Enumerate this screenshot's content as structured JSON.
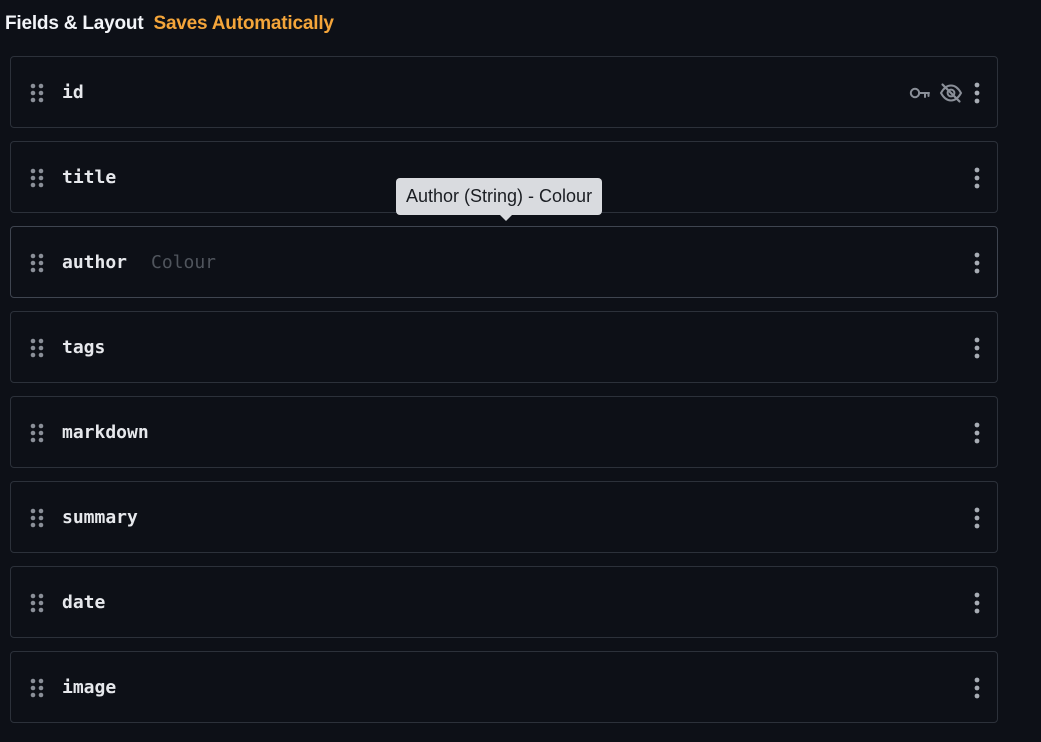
{
  "header": {
    "title": "Fields & Layout",
    "subtitle": "Saves Automatically"
  },
  "colors": {
    "background": "#0d1017",
    "accent": "#f4a53a",
    "border": "#2c313a",
    "text": "#e6e8ec",
    "muted": "#50555d",
    "tooltip_bg": "#d9dbdf"
  },
  "fields": [
    {
      "name": "id",
      "note": "",
      "icons": [
        "key-icon",
        "eye-off-icon",
        "more-vertical-icon"
      ]
    },
    {
      "name": "title",
      "note": "",
      "icons": [
        "more-vertical-icon"
      ]
    },
    {
      "name": "author",
      "note": "Colour",
      "icons": [
        "more-vertical-icon"
      ]
    },
    {
      "name": "tags",
      "note": "",
      "icons": [
        "more-vertical-icon"
      ]
    },
    {
      "name": "markdown",
      "note": "",
      "icons": [
        "more-vertical-icon"
      ]
    },
    {
      "name": "summary",
      "note": "",
      "icons": [
        "more-vertical-icon"
      ]
    },
    {
      "name": "date",
      "note": "",
      "icons": [
        "more-vertical-icon"
      ]
    },
    {
      "name": "image",
      "note": "",
      "icons": [
        "more-vertical-icon"
      ]
    }
  ],
  "tooltip": {
    "text": "Author (String) - Colour"
  }
}
